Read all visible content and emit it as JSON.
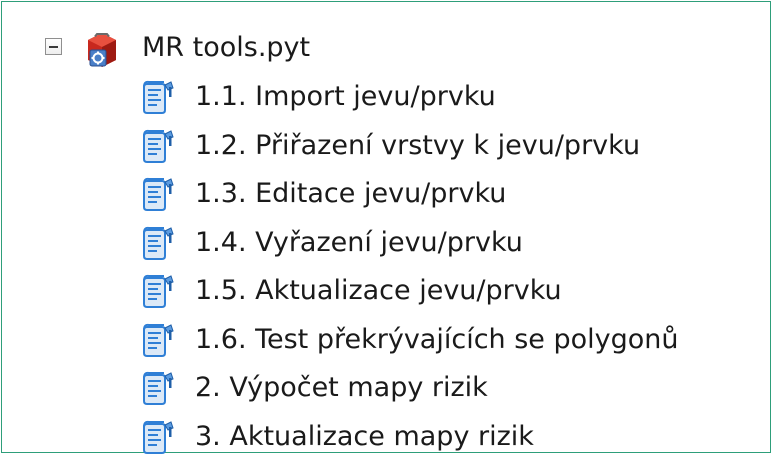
{
  "toolbox": {
    "name": "MR tools.pyt",
    "expanded": true,
    "icon": "toolbox-icon",
    "tools": [
      {
        "label": "1.1. Import jevu/prvku",
        "icon": "script-tool-icon"
      },
      {
        "label": "1.2. Přiřazení vrstvy k jevu/prvku",
        "icon": "script-tool-icon"
      },
      {
        "label": "1.3. Editace jevu/prvku",
        "icon": "script-tool-icon"
      },
      {
        "label": "1.4. Vyřazení jevu/prvku",
        "icon": "script-tool-icon"
      },
      {
        "label": "1.5. Aktualizace jevu/prvku",
        "icon": "script-tool-icon"
      },
      {
        "label": "1.6. Test překrývajících se polygonů",
        "icon": "script-tool-icon"
      },
      {
        "label": "2. Výpočet mapy rizik",
        "icon": "script-tool-icon"
      },
      {
        "label": "3. Aktualizace mapy rizik",
        "icon": "script-tool-icon"
      }
    ]
  },
  "colors": {
    "frame_border": "#2e9e7a",
    "toolbox_red": "#c8281e",
    "script_blue": "#2f7fd6"
  }
}
